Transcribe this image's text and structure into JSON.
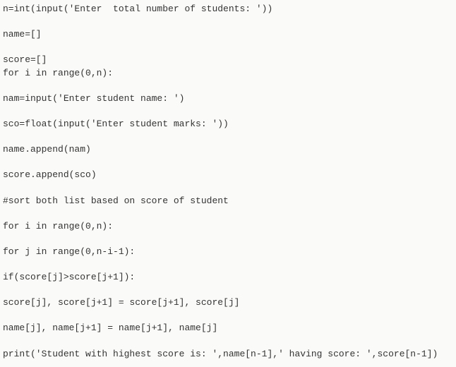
{
  "code": {
    "lines": [
      "n=int(input('Enter  total number of students: '))",
      "",
      "name=[]",
      "",
      "score=[]",
      "for i in range(0,n):",
      "",
      "nam=input('Enter student name: ')",
      "",
      "sco=float(input('Enter student marks: '))",
      "",
      "name.append(nam)",
      "",
      "score.append(sco)",
      "",
      "#sort both list based on score of student",
      "",
      "for i in range(0,n):",
      "",
      "for j in range(0,n-i-1):",
      "",
      "if(score[j]>score[j+1]):",
      "",
      "score[j], score[j+1] = score[j+1], score[j]",
      "",
      "name[j], name[j+1] = name[j+1], name[j]",
      "",
      "print('Student with highest score is: ',name[n-1],' having score: ',score[n-1])"
    ]
  }
}
